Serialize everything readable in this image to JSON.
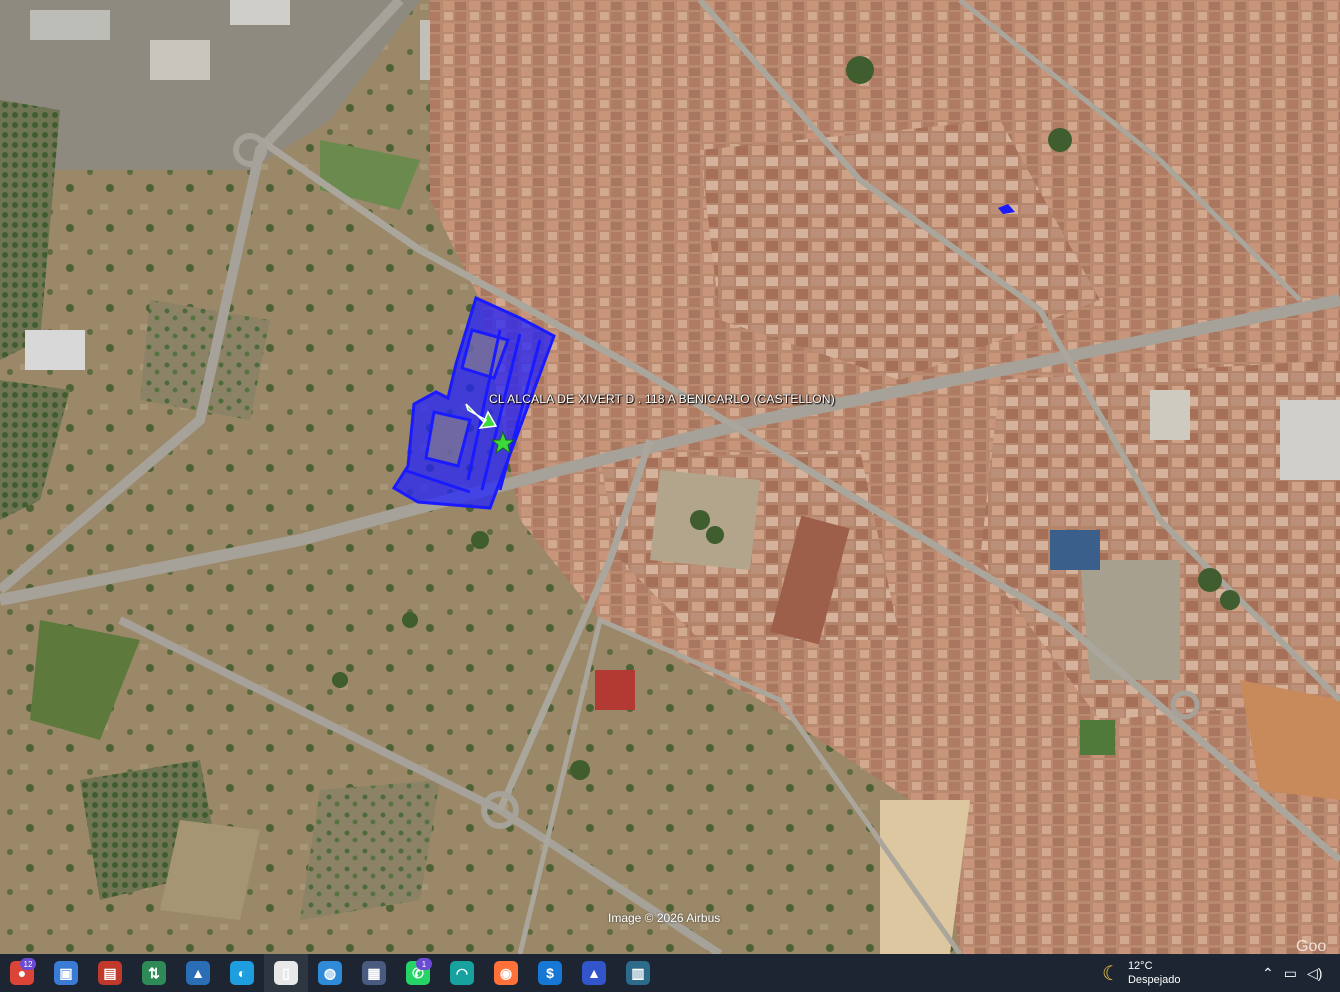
{
  "map": {
    "place_label": "CL ALCALA DE XIVERT D . 118 A BENICARLO (CASTELLON)",
    "attribution": "Image © 2026 Airbus",
    "corner_logo": "Goo",
    "overlay_color": "#1a1aff",
    "pin_color": "#3cd93c"
  },
  "taskbar": {
    "apps": [
      {
        "name": "chrome-icon",
        "glyph": "●",
        "color": "#db4437",
        "badge": "12"
      },
      {
        "name": "picture-app-icon",
        "glyph": "▣",
        "color": "#3a7bd5"
      },
      {
        "name": "window-app-icon",
        "glyph": "▤",
        "color": "#c0392b"
      },
      {
        "name": "lock-app-icon",
        "glyph": "⇅",
        "color": "#2e8b57"
      },
      {
        "name": "photos-app-icon",
        "glyph": "▲",
        "color": "#2a6fb5"
      },
      {
        "name": "edge-icon",
        "glyph": "◐",
        "color": "#1e9ede"
      },
      {
        "name": "notepad-icon",
        "glyph": "▯",
        "color": "#e8e8e8",
        "active": true
      },
      {
        "name": "globe-app-icon",
        "glyph": "◍",
        "color": "#2f8bd8"
      },
      {
        "name": "save-disk-icon",
        "glyph": "▦",
        "color": "#4a5a80"
      },
      {
        "name": "whatsapp-icon",
        "glyph": "✆",
        "color": "#25d366",
        "badge": "1"
      },
      {
        "name": "wifi-app-icon",
        "glyph": "◠",
        "color": "#17a2a0"
      },
      {
        "name": "firefox-icon",
        "glyph": "◉",
        "color": "#ff7139"
      },
      {
        "name": "dollar-app-icon",
        "glyph": "$",
        "color": "#1777d4"
      },
      {
        "name": "arrow-app-icon",
        "glyph": "▲",
        "color": "#3355cc"
      },
      {
        "name": "board-app-icon",
        "glyph": "▥",
        "color": "#2d6b8a"
      }
    ],
    "weather": {
      "temp": "12°C",
      "condition": "Despejado"
    }
  }
}
